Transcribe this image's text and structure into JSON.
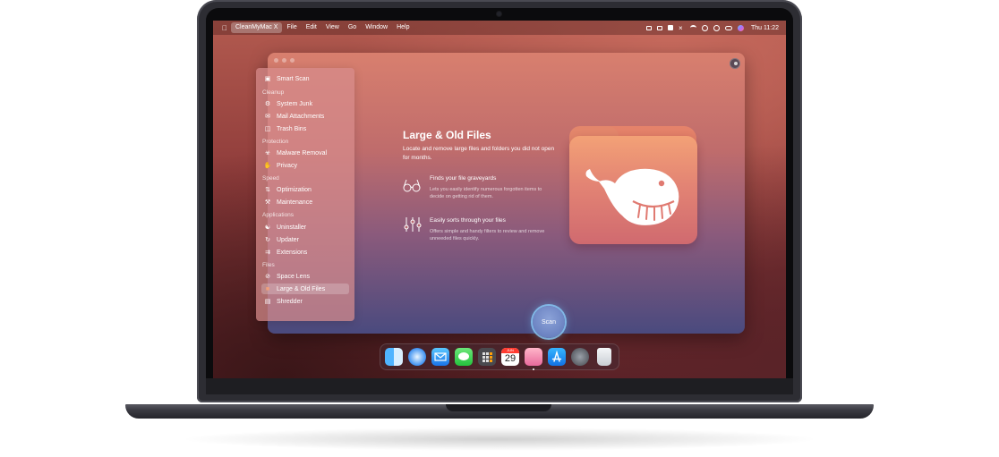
{
  "menubar": {
    "app_name": "CleanMyMac X",
    "menus": [
      "File",
      "Edit",
      "View",
      "Go",
      "Window",
      "Help"
    ],
    "clock": "Thu 11:22",
    "status_icons": [
      "display-icon",
      "airplay-icon",
      "app-menu-icon",
      "mute-icon",
      "wifi-icon",
      "user-icon",
      "search-icon",
      "control-center-icon",
      "siri-icon"
    ]
  },
  "sidebar": {
    "top_item": {
      "label": "Smart Scan",
      "icon": "smart-scan-icon"
    },
    "sections": [
      {
        "title": "Cleanup",
        "items": [
          {
            "label": "System Junk",
            "icon": "system-junk-icon"
          },
          {
            "label": "Mail Attachments",
            "icon": "mail-icon"
          },
          {
            "label": "Trash Bins",
            "icon": "trash-icon"
          }
        ]
      },
      {
        "title": "Protection",
        "items": [
          {
            "label": "Malware Removal",
            "icon": "biohazard-icon"
          },
          {
            "label": "Privacy",
            "icon": "hand-icon"
          }
        ]
      },
      {
        "title": "Speed",
        "items": [
          {
            "label": "Optimization",
            "icon": "sliders-icon"
          },
          {
            "label": "Maintenance",
            "icon": "wrench-icon"
          }
        ]
      },
      {
        "title": "Applications",
        "items": [
          {
            "label": "Uninstaller",
            "icon": "uninstaller-icon"
          },
          {
            "label": "Updater",
            "icon": "updater-icon"
          },
          {
            "label": "Extensions",
            "icon": "extensions-icon"
          }
        ]
      },
      {
        "title": "Files",
        "items": [
          {
            "label": "Space Lens",
            "icon": "space-lens-icon"
          },
          {
            "label": "Large & Old Files",
            "icon": "folder-icon",
            "active": true
          },
          {
            "label": "Shredder",
            "icon": "shredder-icon"
          }
        ]
      }
    ]
  },
  "main": {
    "title": "Large & Old Files",
    "subtitle": "Locate and remove large files and folders you did not open for months.",
    "features": [
      {
        "icon": "glasses-icon",
        "title": "Finds your file graveyards",
        "desc": "Lets you easily identify numerous forgotten items to decide on getting rid of them."
      },
      {
        "icon": "sliders-icon",
        "title": "Easily sorts through your files",
        "desc": "Offers simple and handy filters to review and remove unneeded files quickly."
      }
    ],
    "scan_label": "Scan"
  },
  "dock": {
    "apps": [
      "finder-icon",
      "safari-icon",
      "mail-icon",
      "messages-icon",
      "calculator-icon",
      "calendar-icon",
      "cleanmymac-icon",
      "app-store-icon",
      "system-preferences-icon",
      "trash-icon"
    ],
    "calendar_month": "JUN",
    "calendar_day": "29"
  }
}
